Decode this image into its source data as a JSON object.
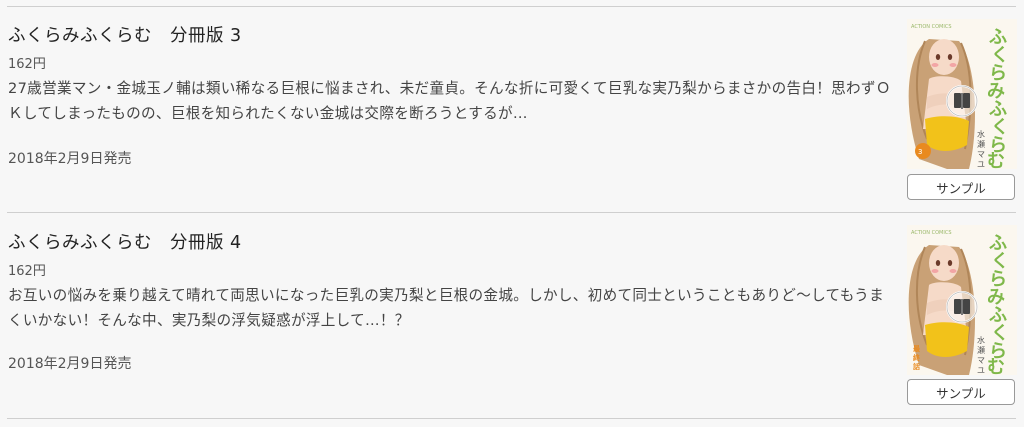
{
  "items": [
    {
      "title": "ふくらみふくらむ　分冊版 3",
      "price": "162円",
      "description": "27歳営業マン・金城玉ノ輔は類い稀なる巨根に悩まされ、未だ童貞。そんな折に可愛くて巨乳な実乃梨からまさかの告白！思わずＯＫしてしまったものの、巨根を知られたくない金城は交際を断ろうとするが…",
      "release_date": "2018年2月9日発売",
      "sample_label": "サンプル",
      "cover": {
        "series_label": "ACTION COMICS",
        "title_vertical": "ふくらみふくらむ",
        "author_vertical": "水瀬マユ",
        "badge": "第3話",
        "icon": "book-preview-icon"
      }
    },
    {
      "title": "ふくらみふくらむ　分冊版 4",
      "price": "162円",
      "description": "お互いの悩みを乗り越えて晴れて両思いになった巨乳の実乃梨と巨根の金城。しかし、初めて同士ということもありど〜してもうまくいかない！そんな中、実乃梨の浮気疑惑が浮上して…！？",
      "release_date": "2018年2月9日発売",
      "sample_label": "サンプル",
      "cover": {
        "series_label": "ACTION COMICS",
        "title_vertical": "ふくらみふくらむ",
        "author_vertical": "水瀬マユ",
        "badge": "最終話",
        "icon": "book-preview-icon"
      }
    }
  ],
  "colors": {
    "title_green": "#7fb84a",
    "badge_orange": "#e98a1f",
    "bikini_yellow": "#f2c21a",
    "hair_tan": "#c9a176"
  }
}
